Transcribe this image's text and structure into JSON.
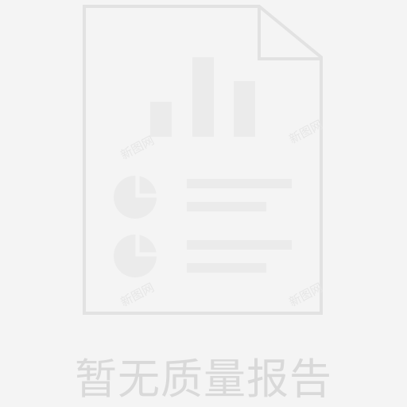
{
  "empty_state": {
    "message": "暂无质量报告",
    "icon": "empty-report-document-icon"
  },
  "watermarks": [
    "新图网",
    "新图网",
    "新图网",
    "新图网"
  ],
  "colors": {
    "background": "#f4f4f4",
    "icon_stroke": "#e2e2e2",
    "icon_fill": "#ebebeb",
    "message_text": "#d9d9d9",
    "watermark_text": "#e6e6e6"
  }
}
